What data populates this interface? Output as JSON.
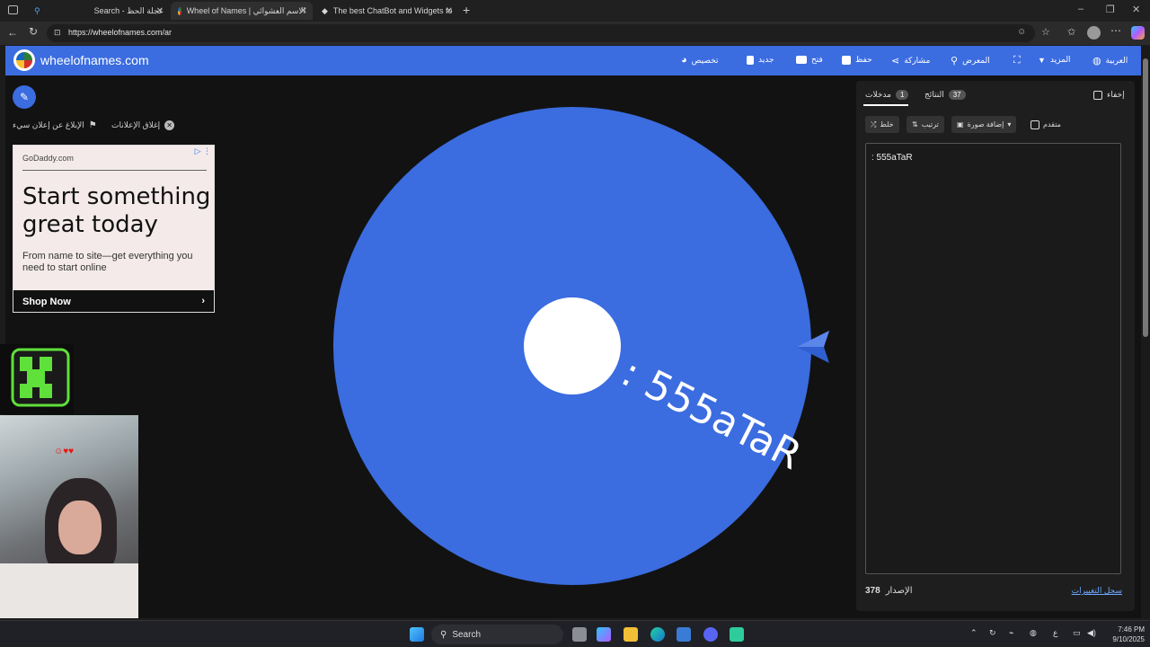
{
  "browser": {
    "tabs": [
      {
        "label": "Search - عجلة الحظ"
      },
      {
        "label": "Wheel of Names | الاسم العشوائي"
      },
      {
        "label": "The best ChatBot and Widgets fo"
      }
    ],
    "url": "https://wheelofnames.com/ar"
  },
  "header": {
    "site_name": "wheelofnames.com",
    "nav": {
      "customize": "تخصيص",
      "new": "جديد",
      "open": "فتح",
      "save": "حفظ",
      "share": "مشاركة",
      "gallery": "المعرض",
      "more": "المزيد",
      "language": "العربية"
    }
  },
  "left": {
    "report_ad": "الإبلاغ عن إعلان سيء",
    "close_ads": "إغلاق الإعلانات"
  },
  "ad": {
    "domain": "GoDaddy.com",
    "headline": "Start something great today",
    "subtext": "From name to site—get everything you need to start online",
    "cta": "Shop Now"
  },
  "wheel": {
    "segment_label": ": 555aTaR",
    "color": "#3b6ce0"
  },
  "panel": {
    "tab_entries": "مدخلات",
    "tab_entries_count": "1",
    "tab_results": "النتائج",
    "tab_results_count": "37",
    "hide_label": "إخفاء",
    "shuffle": "خلط",
    "sort": "ترتيب",
    "add_image": "إضافة صورة",
    "advanced": "متقدم",
    "entry_text": ": 555aTaR",
    "version_label": "الإصدار",
    "version_number": "378",
    "changelog": "سجل التغييرات"
  },
  "taskbar": {
    "search": "Search",
    "time": "7:46 PM",
    "date": "9/10/2025",
    "lang": "ع"
  },
  "colors": {
    "accent": "#3b6ce0",
    "background": "#121212"
  }
}
